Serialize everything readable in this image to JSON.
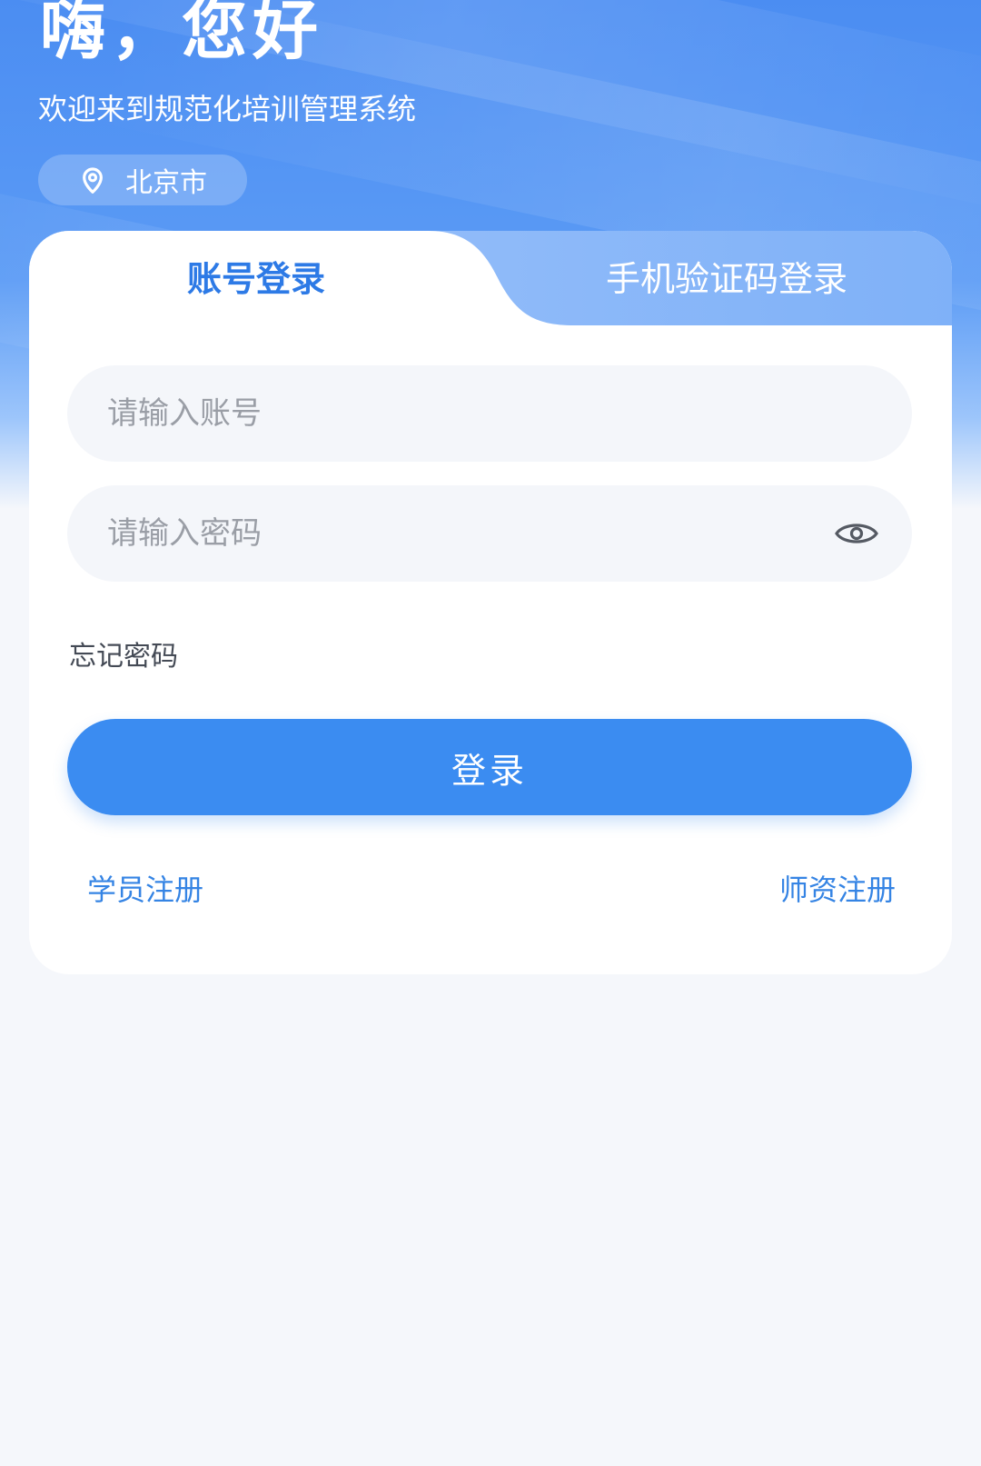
{
  "header": {
    "greeting": "嗨，您好",
    "subtitle": "欢迎来到规范化培训管理系统",
    "location": "北京市"
  },
  "tabs": [
    {
      "label": "账号登录",
      "active": true
    },
    {
      "label": "手机验证码登录",
      "active": false
    }
  ],
  "form": {
    "account_placeholder": "请输入账号",
    "account_value": "",
    "password_placeholder": "请输入密码",
    "password_value": "",
    "forgot_label": "忘记密码",
    "login_label": "登录"
  },
  "links": {
    "student_register": "学员注册",
    "teacher_register": "师资注册"
  },
  "colors": {
    "accent": "#3b8cf1",
    "header_blue": "#4b8df2",
    "link": "#3584e4"
  },
  "icons": {
    "location": "map-pin-icon",
    "password_toggle": "eye-icon"
  }
}
